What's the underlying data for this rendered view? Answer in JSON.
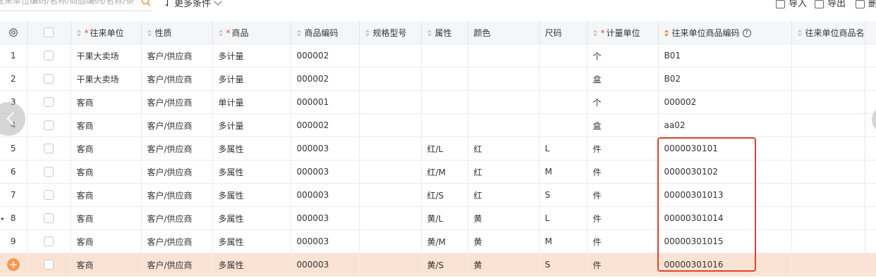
{
  "toolbar": {
    "search_placeholder": "往来单位编码/名称/商品编码/名称/条",
    "more_label": "更多条件",
    "import_label": "导入",
    "export_label": "导出",
    "delete_label": "删"
  },
  "table": {
    "headers": [
      "往来单位",
      "性质",
      "商品",
      "商品编码",
      "规格型号",
      "属性",
      "颜色",
      "尺码",
      "计量单位",
      "往来单位商品编码",
      "往来单位商品名"
    ],
    "rows": [
      {
        "no": "1",
        "partner": "干果大卖场",
        "nature": "客户/供应商",
        "product": "多计量",
        "code": "000002",
        "spec": "",
        "attr": "",
        "color": "",
        "size": "",
        "unit": "个",
        "pcode": "B01",
        "pname": ""
      },
      {
        "no": "2",
        "partner": "干果大卖场",
        "nature": "客户/供应商",
        "product": "多计量",
        "code": "000002",
        "spec": "",
        "attr": "",
        "color": "",
        "size": "",
        "unit": "盒",
        "pcode": "B02",
        "pname": ""
      },
      {
        "no": "3",
        "partner": "客商",
        "nature": "客户/供应商",
        "product": "单计量",
        "code": "000001",
        "spec": "",
        "attr": "",
        "color": "",
        "size": "",
        "unit": "个",
        "pcode": "000002",
        "pname": ""
      },
      {
        "no": "4",
        "partner": "客商",
        "nature": "客户/供应商",
        "product": "多计量",
        "code": "000002",
        "spec": "",
        "attr": "",
        "color": "",
        "size": "",
        "unit": "盒",
        "pcode": "aa02",
        "pname": ""
      },
      {
        "no": "5",
        "partner": "客商",
        "nature": "客户/供应商",
        "product": "多属性",
        "code": "000003",
        "spec": "",
        "attr": "红/L",
        "color": "红",
        "size": "L",
        "unit": "件",
        "pcode": "0000030101",
        "pname": ""
      },
      {
        "no": "6",
        "partner": "客商",
        "nature": "客户/供应商",
        "product": "多属性",
        "code": "000003",
        "spec": "",
        "attr": "红/M",
        "color": "红",
        "size": "M",
        "unit": "件",
        "pcode": "0000030102",
        "pname": ""
      },
      {
        "no": "7",
        "partner": "客商",
        "nature": "客户/供应商",
        "product": "多属性",
        "code": "000003",
        "spec": "",
        "attr": "红/S",
        "color": "红",
        "size": "S",
        "unit": "件",
        "pcode": "00000301013",
        "pname": ""
      },
      {
        "no": "8",
        "partner": "客商",
        "nature": "客户/供应商",
        "product": "多属性",
        "code": "000003",
        "spec": "",
        "attr": "黄/L",
        "color": "黄",
        "size": "L",
        "unit": "件",
        "pcode": "00000301014",
        "pname": ""
      },
      {
        "no": "9",
        "partner": "客商",
        "nature": "客户/供应商",
        "product": "多属性",
        "code": "000003",
        "spec": "",
        "attr": "黄/M",
        "color": "黄",
        "size": "M",
        "unit": "件",
        "pcode": "00000301015",
        "pname": ""
      },
      {
        "no": "+",
        "partner": "客商",
        "nature": "客户/供应商",
        "product": "多属性",
        "code": "000003",
        "spec": "",
        "attr": "黄/S",
        "color": "黄",
        "size": "S",
        "unit": "件",
        "pcode": "00000301016",
        "pname": ""
      }
    ]
  },
  "colors": {
    "accent": "#f08c3c",
    "highlight_row": "#fbe3d3",
    "box": "#e0432f",
    "required": "#f0483c"
  }
}
